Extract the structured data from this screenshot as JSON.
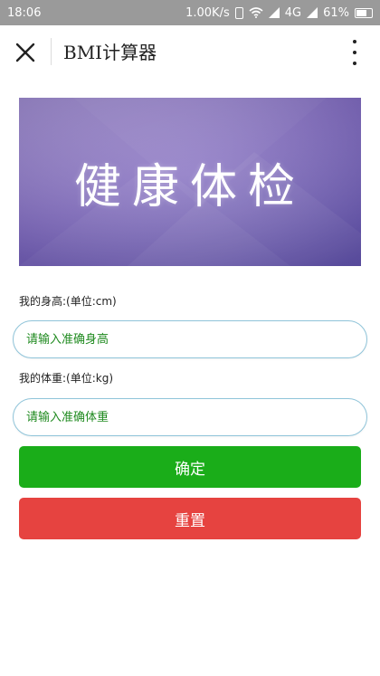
{
  "status": {
    "time": "18:06",
    "network_speed": "1.00K/s",
    "network_type": "4G",
    "battery": "61%"
  },
  "navbar": {
    "title": "BMI计算器"
  },
  "banner": {
    "text": "健康体检"
  },
  "form": {
    "height_label": "我的身高:(单位:cm)",
    "height_placeholder": "请输入准确身高",
    "weight_label": "我的体重:(单位:kg)",
    "weight_placeholder": "请输入准确体重"
  },
  "buttons": {
    "confirm_label": "确定",
    "reset_label": "重置"
  },
  "colors": {
    "confirm": "#1aad19",
    "reset": "#e64340",
    "placeholder": "#1f8a1f",
    "input_border": "#8fc4d9"
  }
}
